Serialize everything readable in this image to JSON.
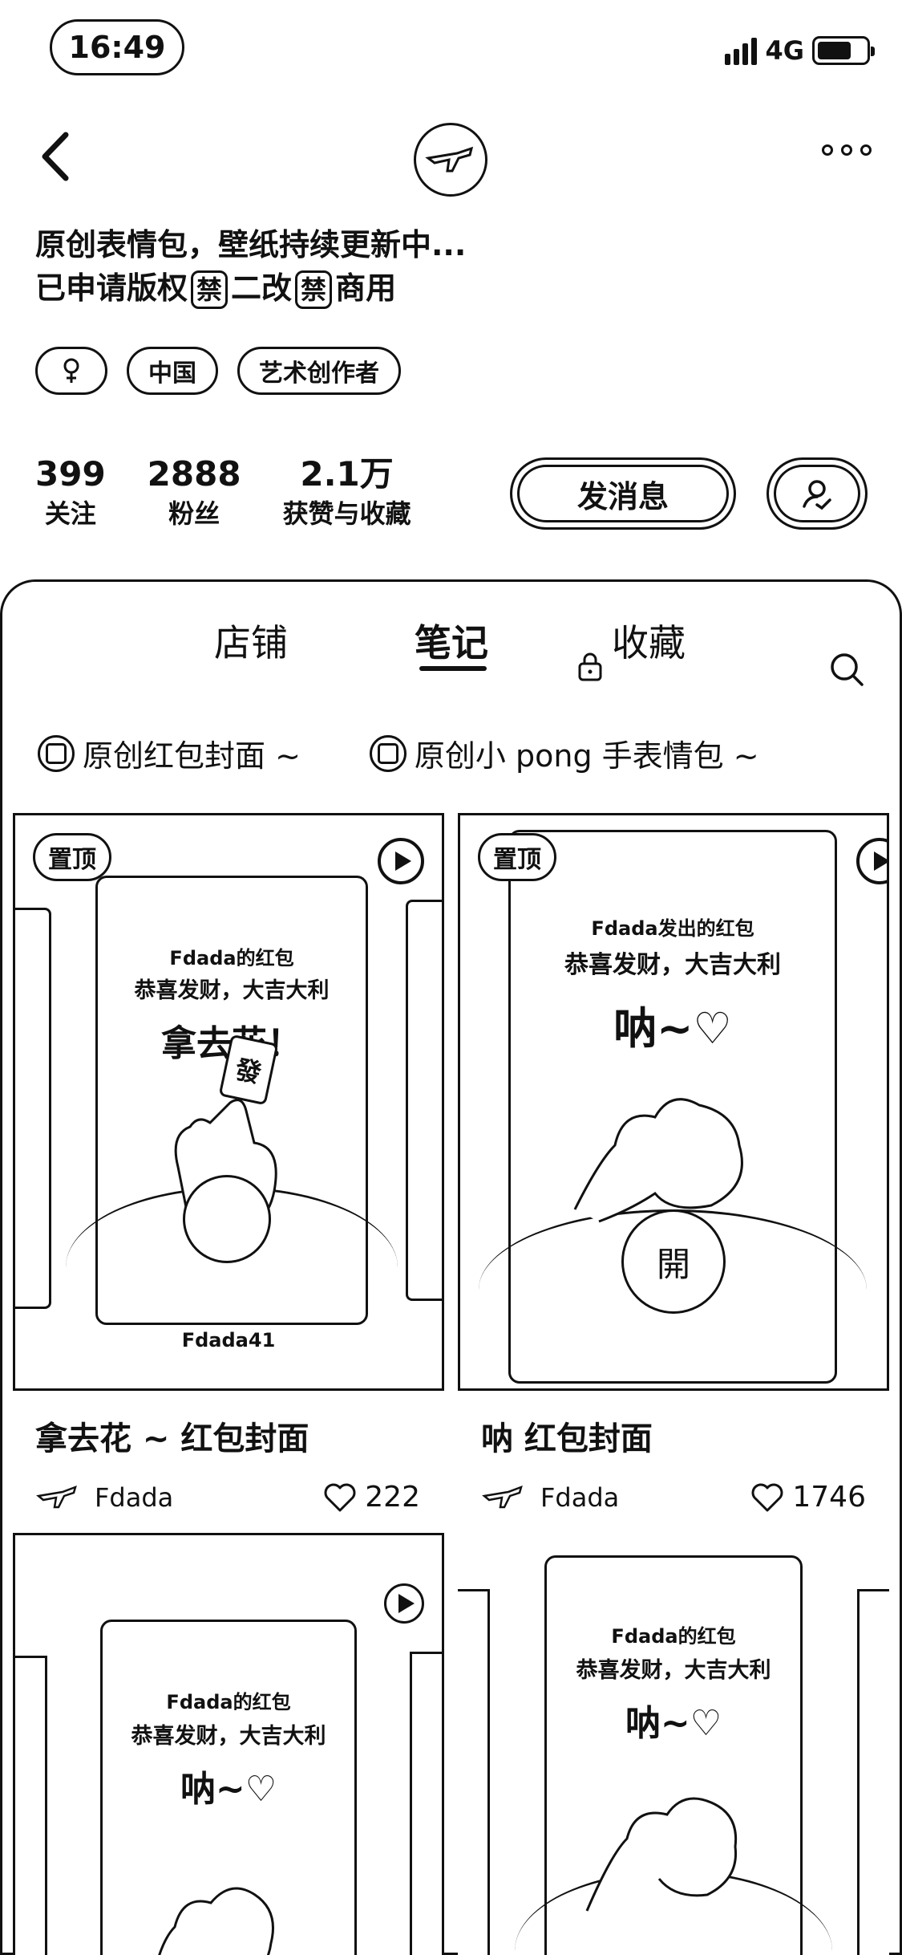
{
  "status": {
    "time": "16:49",
    "network": "4G",
    "battery_level": 0.7
  },
  "profile": {
    "bio_line1": "原创表情包，壁纸持续更新中...",
    "bio_line2_a": "已申请版权",
    "bio_ban1": "禁",
    "bio_line2_b": "二改",
    "bio_ban2": "禁",
    "bio_line2_c": "商用",
    "tags": [
      "中国",
      "艺术创作者"
    ],
    "stats": [
      {
        "num": "399",
        "label": "关注"
      },
      {
        "num": "2888",
        "label": "粉丝"
      },
      {
        "num": "2.1万",
        "label": "获赞与收藏"
      }
    ],
    "message_button": "发消息"
  },
  "tabs": {
    "shop": "店铺",
    "notes": "笔记",
    "favorites": "收藏"
  },
  "collections": [
    "原创红包封面 ~",
    "原创小 pong 手表情包 ~"
  ],
  "posts": [
    {
      "pin_label": "置顶",
      "env_from": "Fdada的红包",
      "env_wish": "恭喜发财，大吉大利",
      "env_big": "拿去花！",
      "card_text": "發",
      "caption": "Fdada41",
      "title": "拿去花 ~ 红包封面",
      "author": "Fdada",
      "likes": "222"
    },
    {
      "pin_label": "置顶",
      "env_from": "Fdada发出的红包",
      "env_wish": "恭喜发财，大吉大利",
      "env_big": "呐~♡",
      "open_text": "開",
      "title": "呐 红包封面",
      "author": "Fdada",
      "likes": "1746"
    },
    {
      "env_from": "Fdada的红包",
      "env_wish": "恭喜发财，大吉大利",
      "env_big": "呐~♡"
    },
    {
      "env_from": "Fdada的红包",
      "env_wish": "恭喜发财，大吉大利",
      "env_big": "呐~♡"
    }
  ]
}
